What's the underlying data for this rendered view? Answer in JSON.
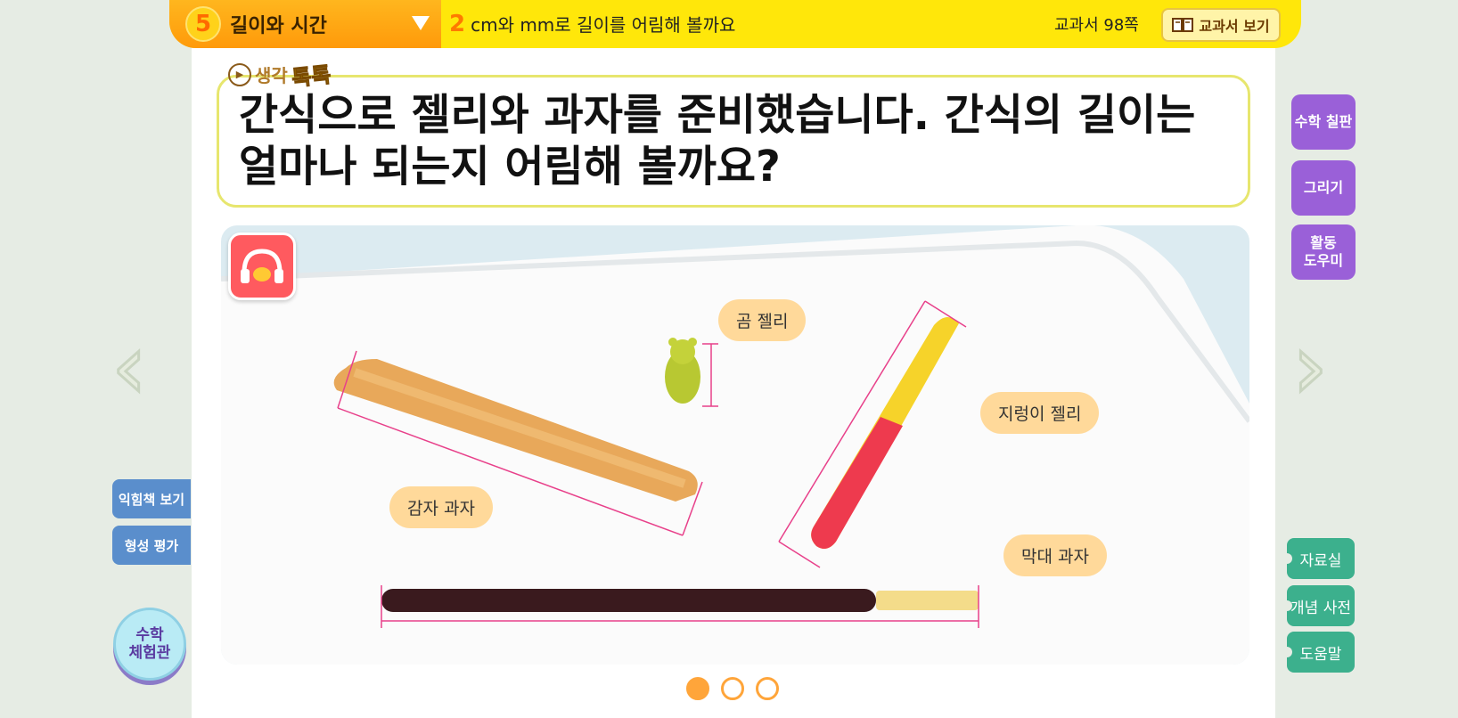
{
  "header": {
    "unit_number": "5",
    "unit_title": "길이와 시간",
    "lesson_number": "2",
    "lesson_title": "cm와 mm로 길이를 어림해 볼까요",
    "page_ref": "교과서  98쪽",
    "textbook_button": "교과서 보기"
  },
  "think_badge": {
    "label": "생각",
    "accent": "톡톡"
  },
  "question": {
    "line1": "간식으로 젤리와 과자를 준비했습니다. 간식의 길이는",
    "line2": "얼마나 되는지 어림해 볼까요?"
  },
  "scene": {
    "labels": {
      "bear": "곰 젤리",
      "worm": "지렁이 젤리",
      "potato": "감자 과자",
      "stick": "막대 과자"
    }
  },
  "left_panel": {
    "workbook": "익힘책 보기",
    "formative": "형성 평가",
    "experience_line1": "수학",
    "experience_line2": "체험관"
  },
  "right_panel": {
    "blackboard": "수학 칠판",
    "draw": "그리기",
    "helper_line1": "활동",
    "helper_line2": "도우미",
    "materials": "자료실",
    "dictionary": "개념 사전",
    "help": "도움말"
  },
  "pagination": {
    "pages": 3,
    "current": 1
  },
  "colors": {
    "header": "#ffe70a",
    "unit_pill": "#ff9a0a",
    "puzzle": "#9a60d8",
    "green": "#3cb08d",
    "blue": "#5a8ecc",
    "audio": "#ff5a5f",
    "measure_line": "#e8408a"
  }
}
